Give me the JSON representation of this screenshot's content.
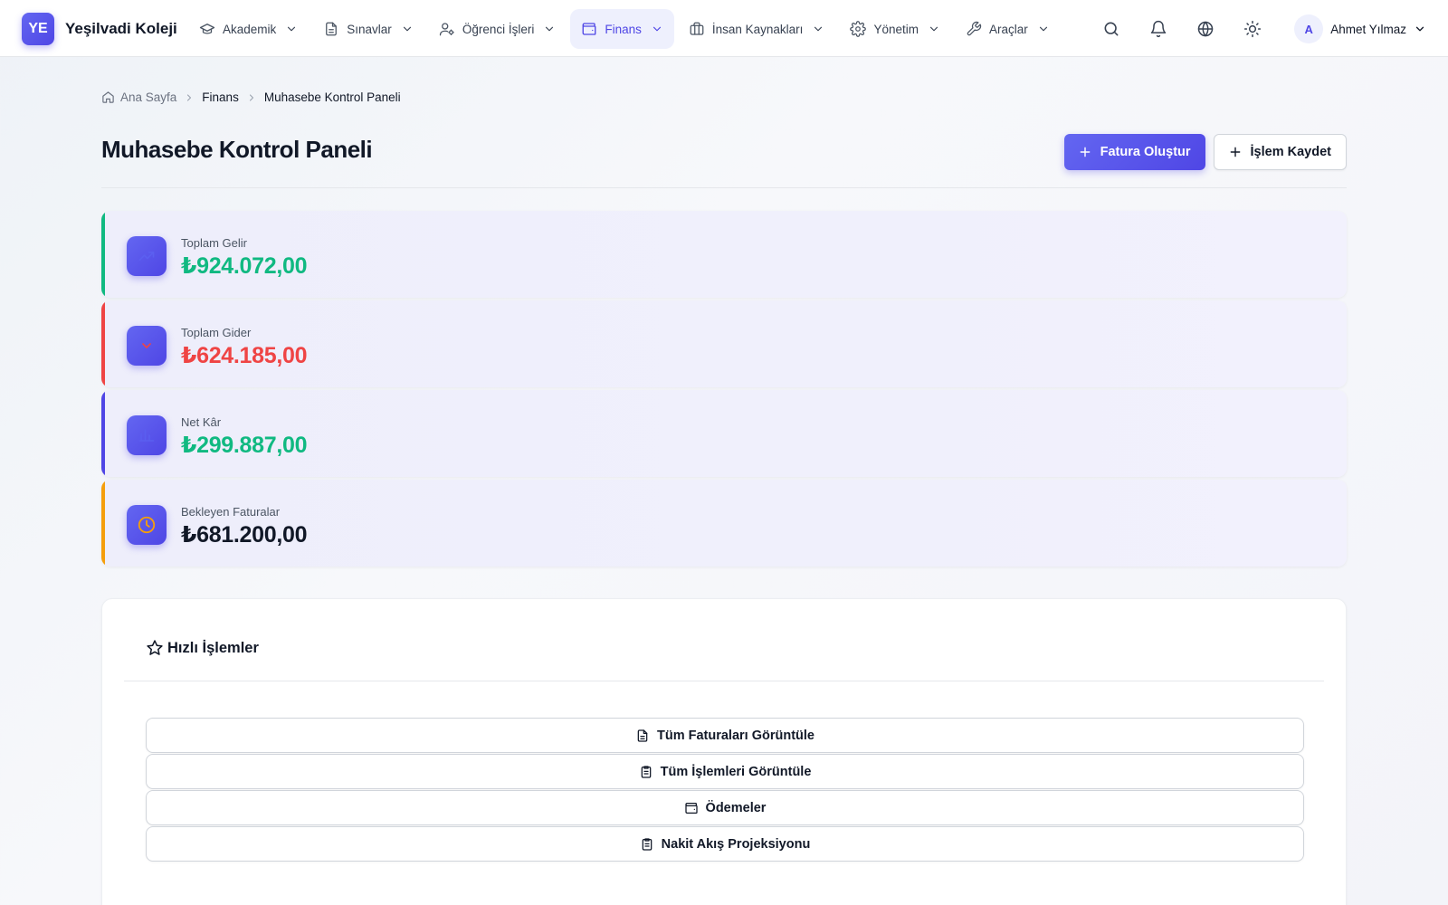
{
  "brand": {
    "initials": "YE",
    "name": "Yeşilvadi Koleji"
  },
  "nav": {
    "items": [
      {
        "label": "Akademik",
        "icon": "graduation-cap-icon"
      },
      {
        "label": "Sınavlar",
        "icon": "document-icon"
      },
      {
        "label": "Öğrenci İşleri",
        "icon": "user-settings-icon"
      },
      {
        "label": "Finans",
        "icon": "wallet-icon",
        "active": true
      },
      {
        "label": "İnsan Kaynakları",
        "icon": "briefcase-icon"
      },
      {
        "label": "Yönetim",
        "icon": "gear-icon"
      },
      {
        "label": "Araçlar",
        "icon": "wrench-icon"
      }
    ]
  },
  "user": {
    "initial": "A",
    "name": "Ahmet Yılmaz"
  },
  "breadcrumb": {
    "home": "Ana Sayfa",
    "section": "Finans",
    "current": "Muhasebe Kontrol Paneli"
  },
  "page": {
    "title": "Muhasebe Kontrol Paneli",
    "primary_action": "Fatura Oluştur",
    "secondary_action": "İşlem Kaydet"
  },
  "stats": [
    {
      "label": "Toplam Gelir",
      "value": "₺924.072,00",
      "color": "#10b981",
      "accent": "#10b981",
      "icon": "trend-up-icon"
    },
    {
      "label": "Toplam Gider",
      "value": "₺624.185,00",
      "color": "#ef4444",
      "accent": "#ef4444",
      "icon": "chevron-down-icon"
    },
    {
      "label": "Net Kâr",
      "value": "₺299.887,00",
      "color": "#10b981",
      "accent": "#4f46e5",
      "icon": "chart-icon"
    },
    {
      "label": "Bekleyen Faturalar",
      "value": "₺681.200,00",
      "color": "#111827",
      "accent": "#f59e0b",
      "icon": "clock-icon"
    }
  ],
  "quick_actions": {
    "title": "Hızlı İşlemler",
    "items": [
      {
        "label": "Tüm Faturaları Görüntüle",
        "icon": "document-icon"
      },
      {
        "label": "Tüm İşlemleri Görüntüle",
        "icon": "clipboard-icon"
      },
      {
        "label": "Ödemeler",
        "icon": "wallet-icon"
      },
      {
        "label": "Nakit Akış Projeksiyonu",
        "icon": "clipboard-icon"
      }
    ]
  },
  "colors": {
    "accent": "#4f46e5",
    "income": "#10b981",
    "expense": "#ef4444",
    "pending": "#f59e0b"
  }
}
